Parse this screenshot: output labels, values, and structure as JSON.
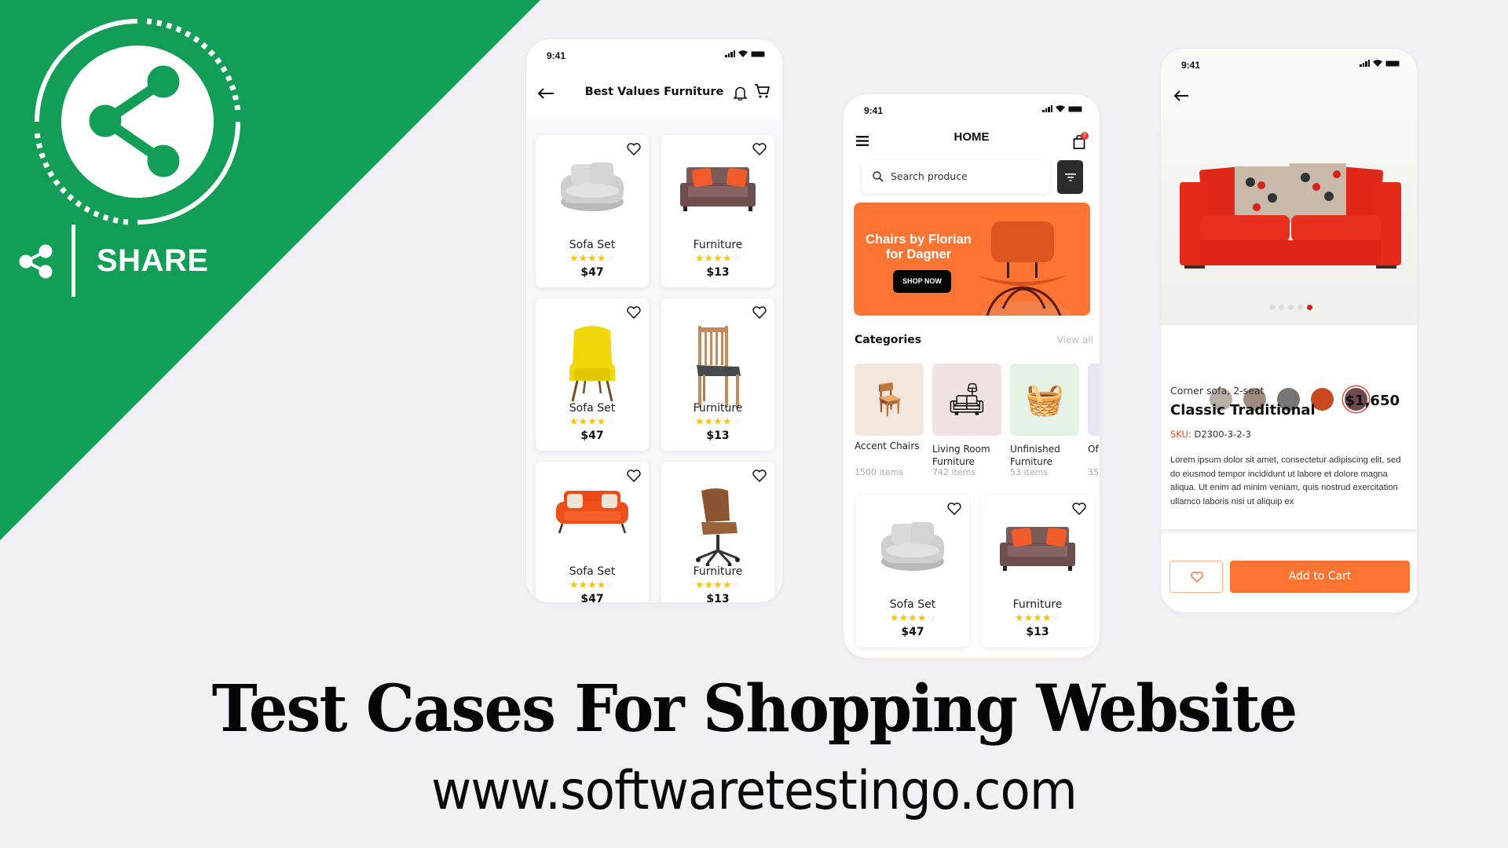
{
  "banner": {
    "share_label": "SHARE",
    "brand_color": "#139e58",
    "title": "Test Cases For Shopping Website",
    "website": "www.softwaretestingo.com"
  },
  "phone_listing": {
    "status_time": "9:41",
    "header_title": "Best Values Furniture",
    "icons": [
      "back-arrow-icon",
      "bell-icon",
      "cart-icon"
    ],
    "products": [
      {
        "name": "Sofa Set",
        "rating": 4,
        "max_rating": 5,
        "price": "$47",
        "image": "grey-swivel-chair"
      },
      {
        "name": "Furniture",
        "rating": 4,
        "max_rating": 5,
        "price": "$13",
        "image": "brown-loveseat"
      },
      {
        "name": "Sofa Set",
        "rating": 4,
        "max_rating": 5,
        "price": "$47",
        "image": "yellow-wingback-chair"
      },
      {
        "name": "Furniture",
        "rating": 4,
        "max_rating": 5,
        "price": "$13",
        "image": "wooden-dining-chair"
      },
      {
        "name": "Sofa Set",
        "rating": 4,
        "max_rating": 5,
        "price": "$47",
        "image": "orange-loveseat"
      },
      {
        "name": "Furniture",
        "rating": 4,
        "max_rating": 5,
        "price": "$13",
        "image": "leather-office-chair"
      }
    ]
  },
  "phone_home": {
    "status_time": "9:41",
    "header_title": "HOME",
    "cart_badge": "2",
    "search_placeholder": "Search produce",
    "promo": {
      "headline_line1": "Chairs by Florian",
      "headline_line2": "for Dagner",
      "cta": "SHOP NOW",
      "color": "#fe7433"
    },
    "categories_title": "Categories",
    "view_all": "View all",
    "categories": [
      {
        "label": "Accent Chairs",
        "count": "1500 items",
        "bg": "#f3e6dd"
      },
      {
        "label": "Living Room Furniture",
        "count": "742 items",
        "bg": "#f2e3e3"
      },
      {
        "label": "Unfinished Furniture",
        "count": "53 items",
        "bg": "#e5f3e6"
      },
      {
        "label": "Of",
        "count": "35",
        "bg": "#e5e7f3"
      }
    ],
    "products": [
      {
        "name": "Sofa Set",
        "rating": 4,
        "max_rating": 5,
        "price": "$47"
      },
      {
        "name": "Furniture",
        "rating": 4,
        "max_rating": 5,
        "price": "$13"
      }
    ]
  },
  "phone_detail": {
    "status_time": "9:41",
    "carousel": {
      "total": 5,
      "active_index": 4
    },
    "swatches": [
      "#b8b0a6",
      "#a08c7e",
      "#7a7673",
      "#c94a22",
      "#6e4a4c"
    ],
    "selected_swatch_index": 4,
    "subtitle": "Corner sofa, 2-seat",
    "title": "Classic Traditional",
    "price": "$1,650",
    "sku_label": "SKU:",
    "sku_value": "D2300-3-2-3",
    "description": "Lorem ipsum dolor sit amet, consectetur adipiscing elit, sed do eiusmod tempor incididunt ut labore et dolore magna aliqua. Ut enim ad minim veniam, quis nostrud exercitation ullamco laboris nisi ut aliquip ex",
    "add_to_cart": "Add to Cart",
    "accent": "#fe7433"
  }
}
